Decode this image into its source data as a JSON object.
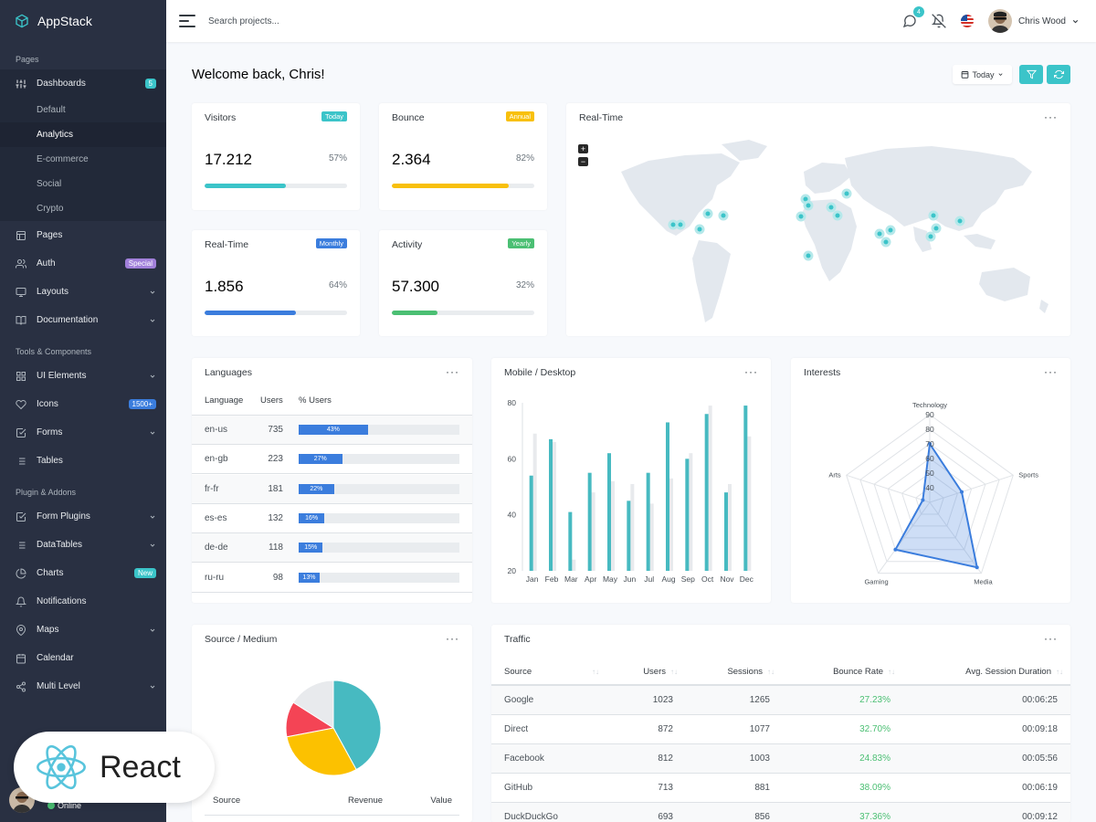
{
  "brand": "AppStack",
  "sidebar": {
    "section_pages": "Pages",
    "section_tools": "Tools & Components",
    "section_plugins": "Plugin & Addons",
    "dashboards": {
      "label": "Dashboards",
      "badge": "5"
    },
    "sub_items": [
      "Default",
      "Analytics",
      "E-commerce",
      "Social",
      "Crypto"
    ],
    "pages": "Pages",
    "auth": {
      "label": "Auth",
      "badge": "Special"
    },
    "layouts": "Layouts",
    "documentation": "Documentation",
    "ui_elements": "UI Elements",
    "icons": {
      "label": "Icons",
      "badge": "1500+"
    },
    "forms": "Forms",
    "tables": "Tables",
    "form_plugins": "Form Plugins",
    "datatables": "DataTables",
    "charts": {
      "label": "Charts",
      "badge": "New"
    },
    "notifications": "Notifications",
    "maps": "Maps",
    "calendar": "Calendar",
    "multi_level": "Multi Level",
    "status": "Online"
  },
  "topbar": {
    "search_placeholder": "Search projects...",
    "messages_count": "4",
    "user_name": "Chris Wood"
  },
  "welcome": "Welcome back, Chris!",
  "today_button": "Today",
  "stats": [
    {
      "title": "Visitors",
      "badge": "Today",
      "badge_color": "#3bc4c9",
      "value": "17.212",
      "percent": "57%",
      "fill": 0.57,
      "bar_color": "#3bc4c9"
    },
    {
      "title": "Bounce",
      "badge": "Annual",
      "badge_color": "#f8c00c",
      "value": "2.364",
      "percent": "82%",
      "fill": 0.82,
      "bar_color": "#f8c00c"
    },
    {
      "title": "Real-Time",
      "badge": "Monthly",
      "badge_color": "#3b7ddd",
      "value": "1.856",
      "percent": "64%",
      "fill": 0.64,
      "bar_color": "#3b7ddd"
    },
    {
      "title": "Activity",
      "badge": "Yearly",
      "badge_color": "#4bbf73",
      "value": "57.300",
      "percent": "32%",
      "fill": 0.32,
      "bar_color": "#4bbf73"
    }
  ],
  "realtime_map": {
    "title": "Real-Time",
    "zoom_in": "+",
    "zoom_out": "−"
  },
  "languages": {
    "title": "Languages",
    "headers": [
      "Language",
      "Users",
      "% Users"
    ],
    "rows": [
      {
        "lang": "en-us",
        "users": "735",
        "pct": "43%",
        "fill": 0.43
      },
      {
        "lang": "en-gb",
        "users": "223",
        "pct": "27%",
        "fill": 0.27
      },
      {
        "lang": "fr-fr",
        "users": "181",
        "pct": "22%",
        "fill": 0.22
      },
      {
        "lang": "es-es",
        "users": "132",
        "pct": "16%",
        "fill": 0.16
      },
      {
        "lang": "de-de",
        "users": "118",
        "pct": "15%",
        "fill": 0.15
      },
      {
        "lang": "ru-ru",
        "users": "98",
        "pct": "13%",
        "fill": 0.13
      }
    ]
  },
  "mobile_desktop": {
    "title": "Mobile / Desktop"
  },
  "interests": {
    "title": "Interests"
  },
  "source_medium": {
    "title": "Source / Medium",
    "headers": [
      "Source",
      "Revenue",
      "Value"
    ]
  },
  "traffic": {
    "title": "Traffic",
    "headers": [
      "Source",
      "Users",
      "Sessions",
      "Bounce Rate",
      "Avg. Session Duration"
    ],
    "rows": [
      [
        "Google",
        "1023",
        "1265",
        "27.23%",
        "00:06:25"
      ],
      [
        "Direct",
        "872",
        "1077",
        "32.70%",
        "00:09:18"
      ],
      [
        "Facebook",
        "812",
        "1003",
        "24.83%",
        "00:05:56"
      ],
      [
        "GitHub",
        "713",
        "881",
        "38.09%",
        "00:06:19"
      ],
      [
        "DuckDuckGo",
        "693",
        "856",
        "37.36%",
        "00:09:12"
      ]
    ]
  },
  "react_badge": "React",
  "chart_data": [
    {
      "type": "bar",
      "categories": [
        "Jan",
        "Feb",
        "Mar",
        "Apr",
        "May",
        "Jun",
        "Jul",
        "Aug",
        "Sep",
        "Oct",
        "Nov",
        "Dec"
      ],
      "series": [
        {
          "values": [
            54,
            67,
            41,
            55,
            62,
            45,
            55,
            73,
            60,
            76,
            48,
            79
          ],
          "color": "#47bac1"
        },
        {
          "values": [
            69,
            66,
            24,
            48,
            52,
            51,
            44,
            53,
            62,
            79,
            51,
            68
          ],
          "color": "#e8eaed"
        }
      ],
      "ylim": [
        20,
        80
      ],
      "yticks": [
        20,
        40,
        60,
        80
      ]
    },
    {
      "type": "radar",
      "axes": [
        "Technology",
        "Sports",
        "Media",
        "Gaming",
        "Arts"
      ],
      "values": [
        70,
        53,
        85,
        70,
        35
      ],
      "ticks": [
        40,
        50,
        60,
        70,
        80,
        90
      ],
      "range": [
        30,
        90
      ],
      "color": "#3b7ddd"
    },
    {
      "type": "pie",
      "values": [
        42,
        30,
        12,
        16
      ],
      "colors": [
        "#47bac1",
        "#fcc100",
        "#f44455",
        "#e8eaed"
      ]
    }
  ]
}
